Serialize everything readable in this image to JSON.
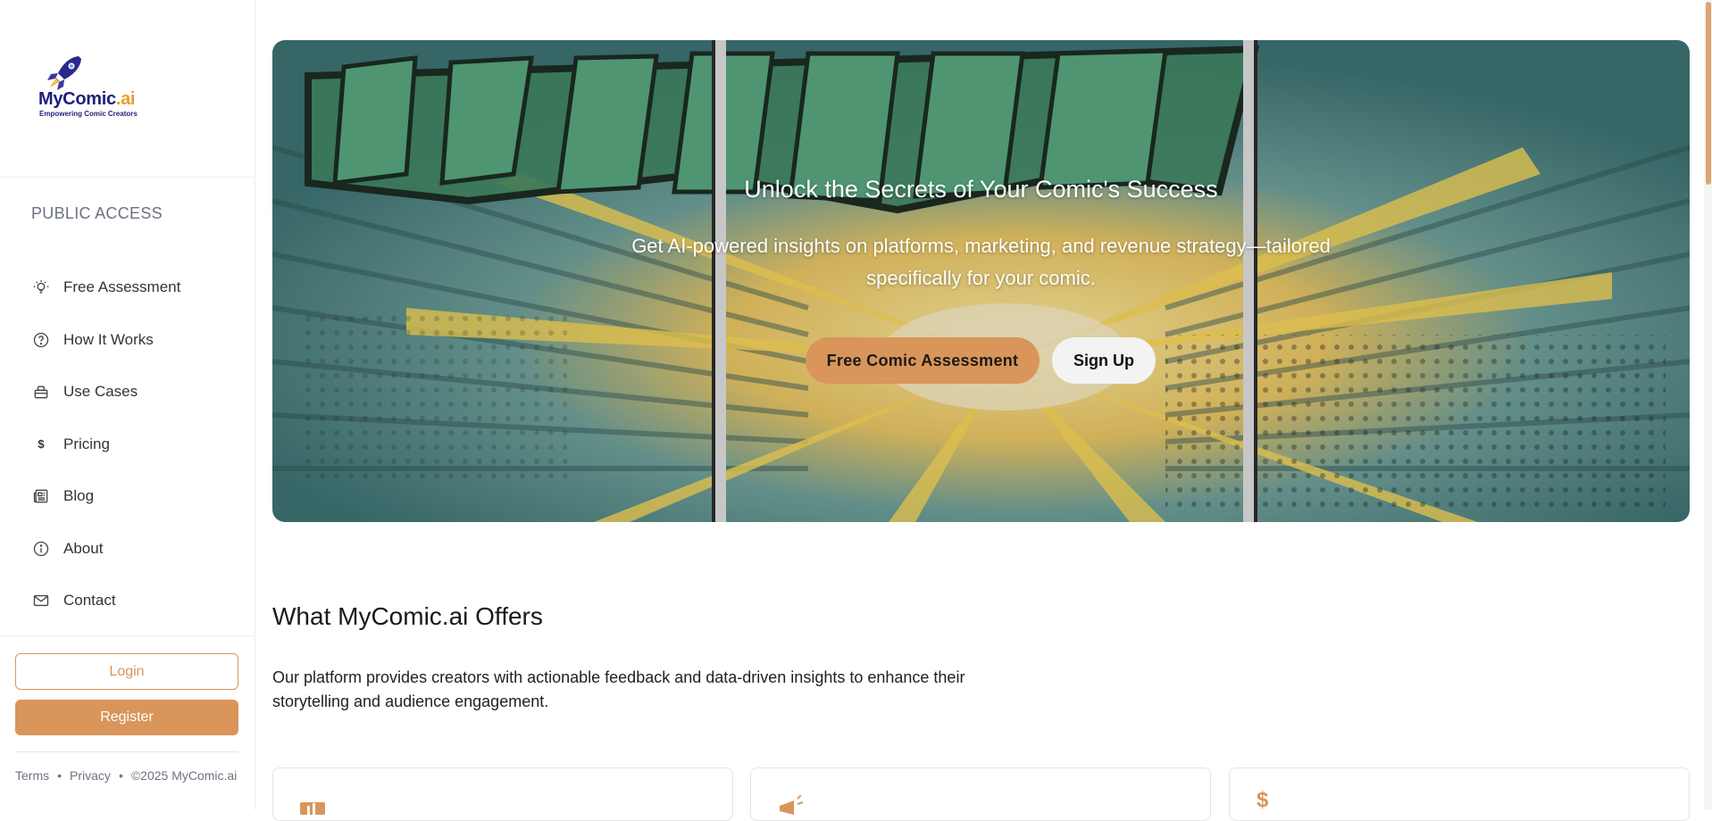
{
  "brand": {
    "name_main": "MyComic",
    "name_suffix": ".ai",
    "tagline": "Empowering Comic Creators"
  },
  "sidebar": {
    "section_label": "PUBLIC ACCESS",
    "items": [
      {
        "label": "Free Assessment",
        "icon": "lightbulb-icon"
      },
      {
        "label": "How It Works",
        "icon": "question-circle-icon"
      },
      {
        "label": "Use Cases",
        "icon": "briefcase-icon"
      },
      {
        "label": "Pricing",
        "icon": "dollar-icon"
      },
      {
        "label": "Blog",
        "icon": "newspaper-icon"
      },
      {
        "label": "About",
        "icon": "info-circle-icon"
      },
      {
        "label": "Contact",
        "icon": "envelope-icon"
      }
    ],
    "login_label": "Login",
    "register_label": "Register",
    "footer": {
      "terms": "Terms",
      "privacy": "Privacy",
      "copyright": "©2025 MyComic.ai"
    }
  },
  "hero": {
    "title": "Unlock the Secrets of Your Comic's Success",
    "subtitle": "Get AI-powered insights on platforms, marketing, and revenue strategy—tailored specifically for your comic.",
    "primary_cta": "Free Comic Assessment",
    "secondary_cta": "Sign Up"
  },
  "offers": {
    "title": "What MyComic.ai Offers",
    "description": "Our platform provides creators with actionable feedback and data-driven insights to enhance their storytelling and audience engagement.",
    "cards": [
      {
        "icon": "chart-icon"
      },
      {
        "icon": "megaphone-icon"
      },
      {
        "icon": "dollar-icon"
      }
    ]
  },
  "colors": {
    "accent": "#d9955a",
    "brand_navy": "#1f1f7a",
    "brand_orange": "#e8a02c"
  }
}
